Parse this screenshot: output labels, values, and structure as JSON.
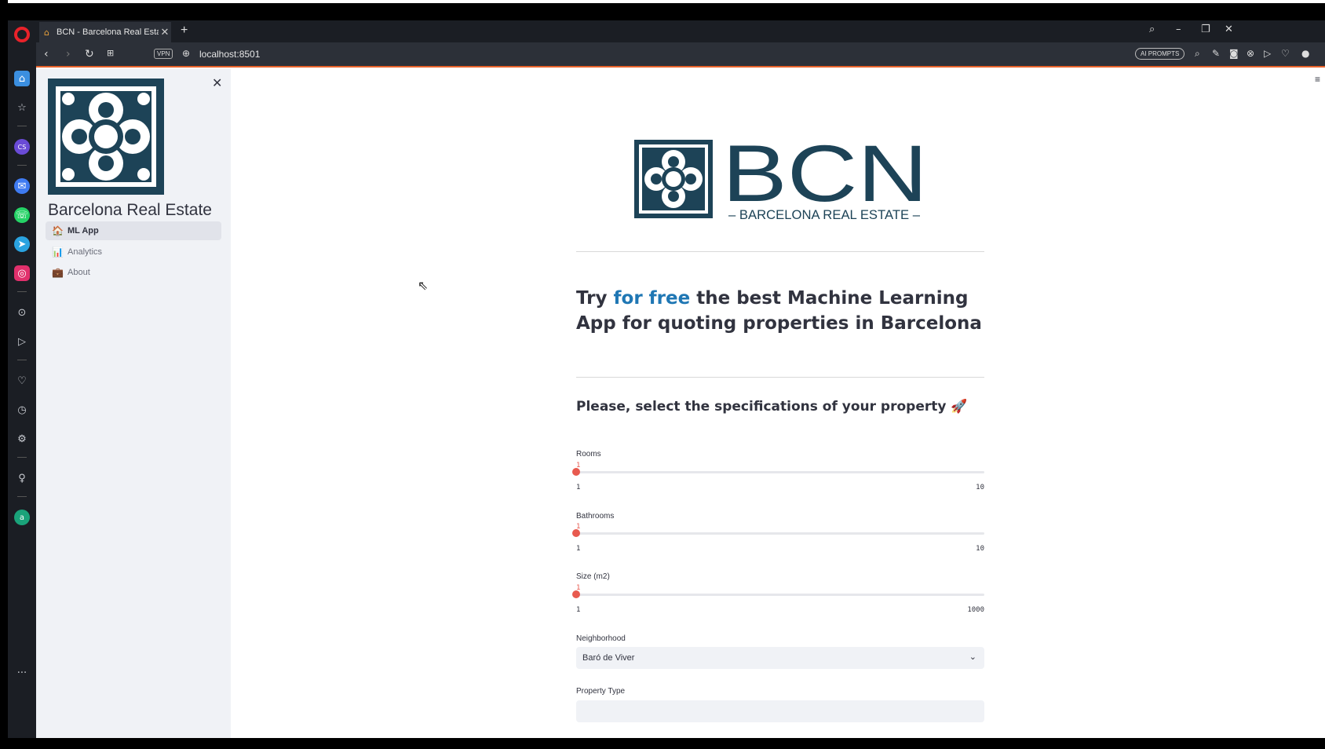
{
  "browser": {
    "tab_title": "BCN - Barcelona Real Estate",
    "tab_close": "✕",
    "new_tab": "+",
    "url": "localhost:8501",
    "vpn_label": "VPN",
    "ai_prompts_label": "AI PROMPTS"
  },
  "sidebar": {
    "title": "Barcelona Real Estate",
    "close": "✕",
    "items": [
      {
        "icon": "🏠",
        "label": "ML App"
      },
      {
        "icon": "📊",
        "label": "Analytics"
      },
      {
        "icon": "💼",
        "label": "About"
      }
    ]
  },
  "hero": {
    "brand": "BCN",
    "tagline": "– BARCELONA REAL ESTATE –"
  },
  "headline": {
    "part1": "Try ",
    "highlight": "for free",
    "part2": " the best Machine Learning App for quoting properties in Barcelona"
  },
  "subhead": "Please, select the specifications of your property 🚀",
  "sliders": [
    {
      "label": "Rooms",
      "value": "1",
      "min": "1",
      "max": "10",
      "fraction": 0
    },
    {
      "label": "Bathrooms",
      "value": "1",
      "min": "1",
      "max": "10",
      "fraction": 0
    },
    {
      "label": "Size (m2)",
      "value": "1",
      "min": "1",
      "max": "1000",
      "fraction": 0
    }
  ],
  "neighborhood": {
    "label": "Neighborhood",
    "value": "Baró de Viver"
  },
  "property_type": {
    "label": "Property Type"
  },
  "colors": {
    "accent": "#e85a4f",
    "brand": "#1d4357",
    "link": "#1f77b4"
  }
}
